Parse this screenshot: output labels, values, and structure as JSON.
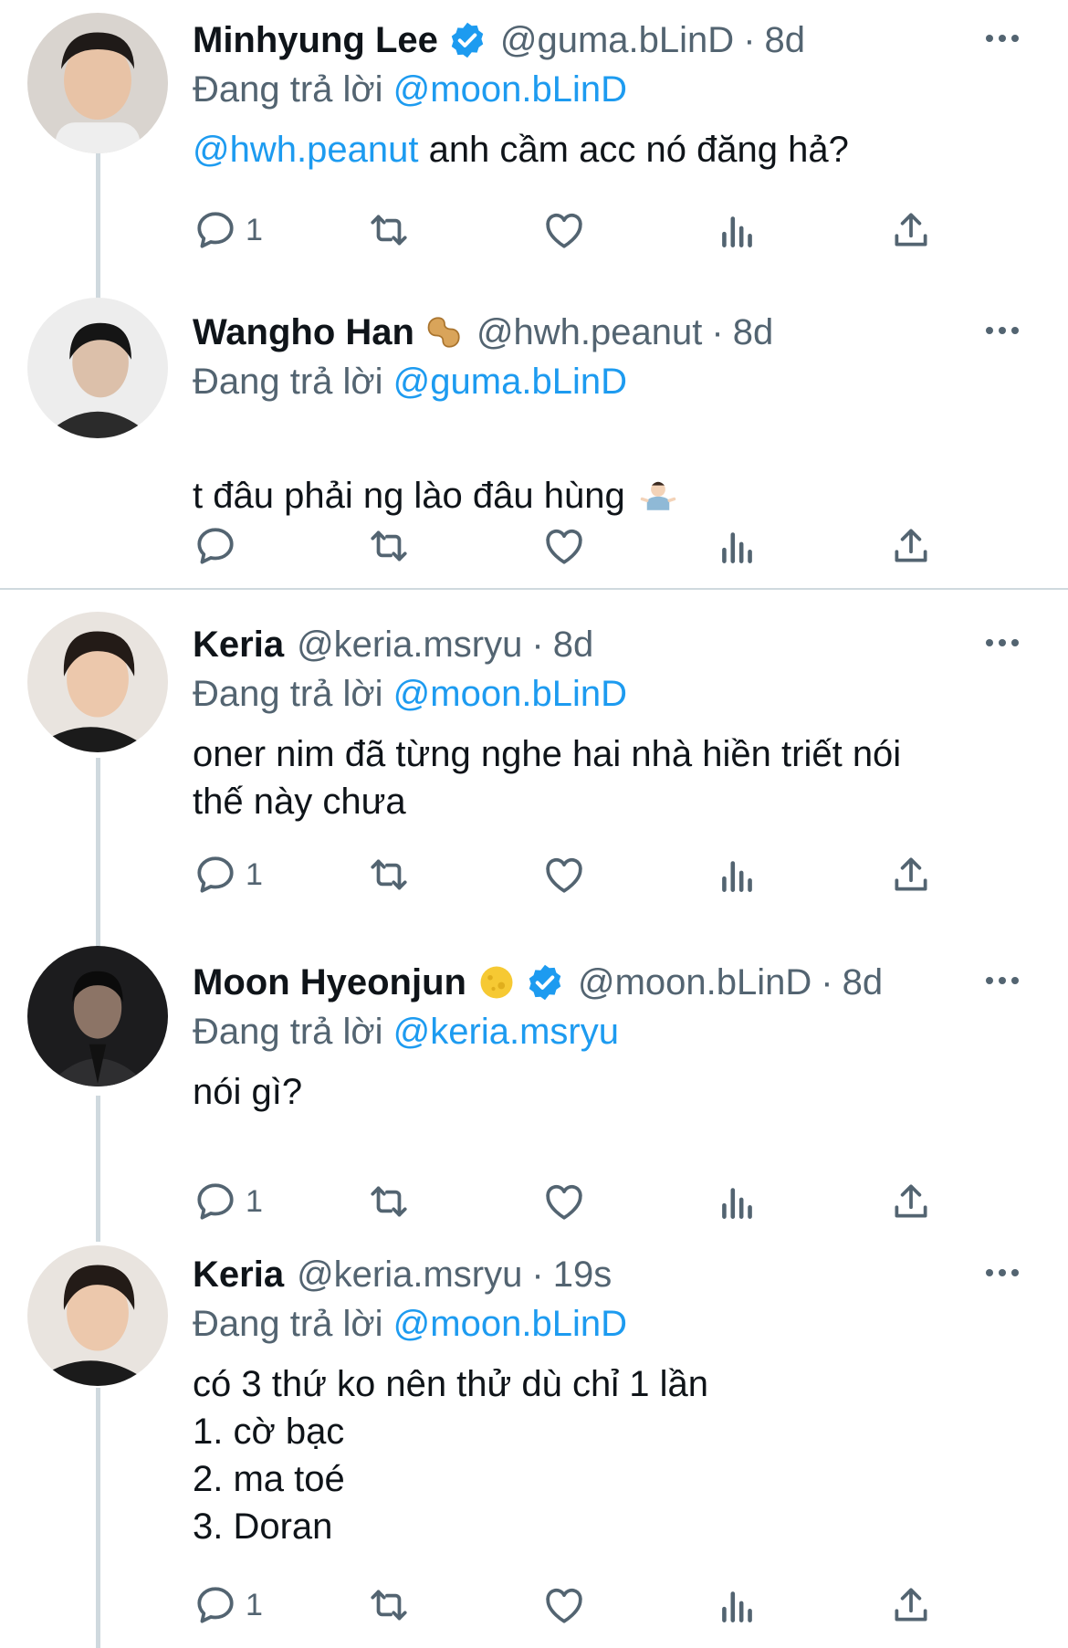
{
  "reply_prefix": "Đang trả lời",
  "colors": {
    "accent": "#1d9bf0",
    "secondary": "#536471",
    "text": "#0f1419",
    "line": "#cfd9de"
  },
  "tweets": [
    {
      "name": "Minhyung Lee",
      "verified": true,
      "name_emoji": null,
      "handle": "@guma.bLinD",
      "time": "8d",
      "reply_to": "@moon.bLinD",
      "body_mention": "@hwh.peanut",
      "body": " anh cầm acc nó đăng hả?",
      "reply_count": "1"
    },
    {
      "name": "Wangho Han",
      "verified": false,
      "name_emoji": "peanut-emoji",
      "handle": "@hwh.peanut",
      "time": "8d",
      "reply_to": "@guma.bLinD",
      "body_mention": "",
      "body": "t đâu phải ng lào đâu hùng",
      "body_emoji": "shrug-emoji",
      "reply_count": ""
    },
    {
      "name": "Keria",
      "verified": false,
      "name_emoji": null,
      "handle": "@keria.msryu",
      "time": "8d",
      "reply_to": "@moon.bLinD",
      "body_mention": "",
      "body": "oner nim đã từng nghe hai nhà hiền triết nói\nthế này chưa",
      "reply_count": "1"
    },
    {
      "name": "Moon Hyeonjun",
      "verified": true,
      "name_emoji": "moon-emoji",
      "handle": "@moon.bLinD",
      "time": "8d",
      "reply_to": "@keria.msryu",
      "body_mention": "",
      "body": "nói gì?",
      "reply_count": "1"
    },
    {
      "name": "Keria",
      "verified": false,
      "name_emoji": null,
      "handle": "@keria.msryu",
      "time": "19s",
      "reply_to": "@moon.bLinD",
      "body_mention": "",
      "body": "có 3 thứ ko nên thử dù chỉ 1 lần\n1. cờ bạc\n2. ma toé\n3. Doran",
      "reply_count": "1"
    }
  ]
}
